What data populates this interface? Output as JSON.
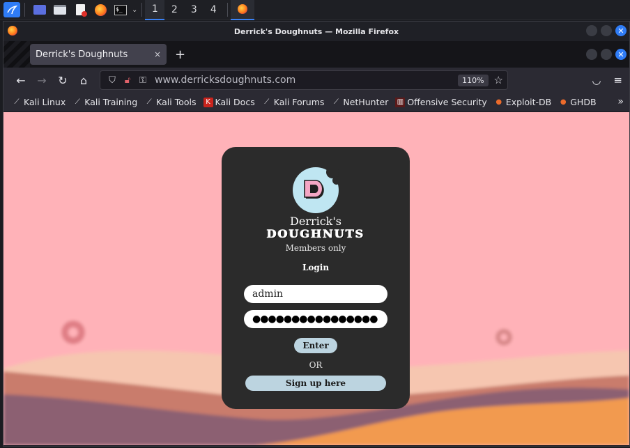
{
  "taskbar": {
    "workspaces": [
      "1",
      "2",
      "3",
      "4"
    ],
    "active_workspace": "1"
  },
  "window": {
    "title": "Derrick's Doughnuts — Mozilla Firefox"
  },
  "tab": {
    "label": "Derrick's Doughnuts",
    "close": "×",
    "new_tab": "+"
  },
  "navbar": {
    "url": "www.derricksdoughnuts.com",
    "zoom": "110%"
  },
  "bookmarks": [
    {
      "label": "Kali Linux",
      "icon": "kali-icon"
    },
    {
      "label": "Kali Training",
      "icon": "kali-icon"
    },
    {
      "label": "Kali Tools",
      "icon": "kali-icon"
    },
    {
      "label": "Kali Docs",
      "icon": "kali-docs-icon"
    },
    {
      "label": "Kali Forums",
      "icon": "kali-icon"
    },
    {
      "label": "NetHunter",
      "icon": "nethunter-icon"
    },
    {
      "label": "Offensive Security",
      "icon": "offsec-icon"
    },
    {
      "label": "Exploit-DB",
      "icon": "exploitdb-icon"
    },
    {
      "label": "GHDB",
      "icon": "ghdb-icon"
    }
  ],
  "page": {
    "brand_line1": "Derrick's",
    "brand_line2": "DOUGHNUTS",
    "logo_letter": "D",
    "subtitle": "Members only",
    "login_heading": "Login",
    "username_value": "admin",
    "password_mask": "●●●●●●●●●●●●●●●●",
    "enter_label": "Enter",
    "or_label": "OR",
    "signup_label": "Sign up here"
  },
  "colors": {
    "page_bg": "#ffb2b8",
    "card_bg": "#2b2b2b",
    "button_bg": "#bcd4e0",
    "accent": "#3b82f6"
  }
}
